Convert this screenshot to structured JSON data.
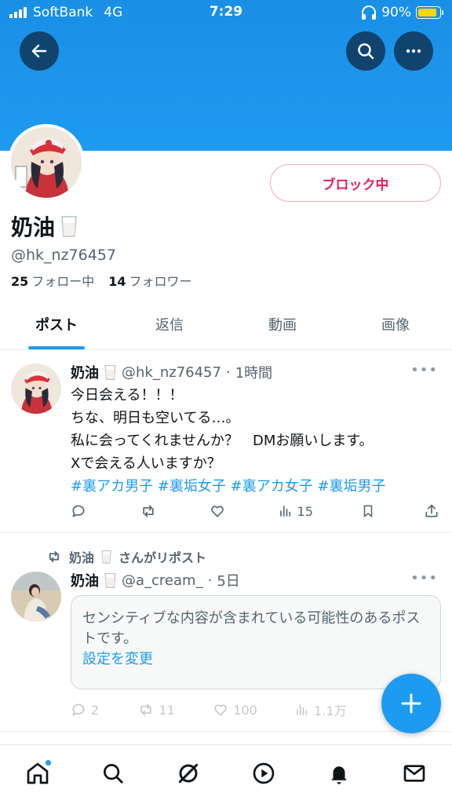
{
  "status_bar": {
    "carrier": "SoftBank",
    "network": "4G",
    "time": "7:29",
    "battery": "90%",
    "battery_level": 0.9
  },
  "header": {
    "back_icon": "arrow-left-icon",
    "search_icon": "search-icon",
    "more_icon": "more-dots-icon"
  },
  "profile": {
    "display_name": "奶油",
    "name_emoji": "milk-glass-icon",
    "handle": "@hk_nz76457",
    "following_count": "25",
    "following_label": "フォロー中",
    "followers_count": "14",
    "followers_label": "フォロワー",
    "block_button": "ブロック中"
  },
  "tabs": [
    "ポスト",
    "返信",
    "動画",
    "画像"
  ],
  "tweets": [
    {
      "name": "奶油",
      "handle": "@hk_nz76457",
      "time": "1時間",
      "lines": [
        "今日会える！！！",
        "ちな、明日も空いてる…。",
        "私に会ってくれませんか？　DMお願いします。",
        "Xで会える人いますか？"
      ],
      "hashtags": "#裏アカ男子 #裏垢女子 #裏アカ女子 #裏垢男子",
      "actions": {
        "replies": "",
        "retweets": "",
        "likes": "",
        "views": "15"
      }
    },
    {
      "repost_label": "奶油 🥛 さんがリポスト",
      "repost_name": "奶油",
      "repost_suffix": "さんがリポスト",
      "name": "奶油",
      "handle": "@a_cream_",
      "time": "5日",
      "sensitive_text": "センシティブな内容が含まれている可能性のあるポストです。",
      "sensitive_link": "設定を変更",
      "actions": {
        "replies": "2",
        "retweets": "11",
        "likes": "100",
        "views": "1.1万"
      }
    }
  ],
  "bottom_nav": [
    "home-icon",
    "search-icon",
    "grok-icon",
    "play-icon",
    "bell-icon",
    "mail-icon"
  ],
  "colors": {
    "accent": "#1d9bf0",
    "block": "#e0245e",
    "header": "#1d9bf0"
  }
}
